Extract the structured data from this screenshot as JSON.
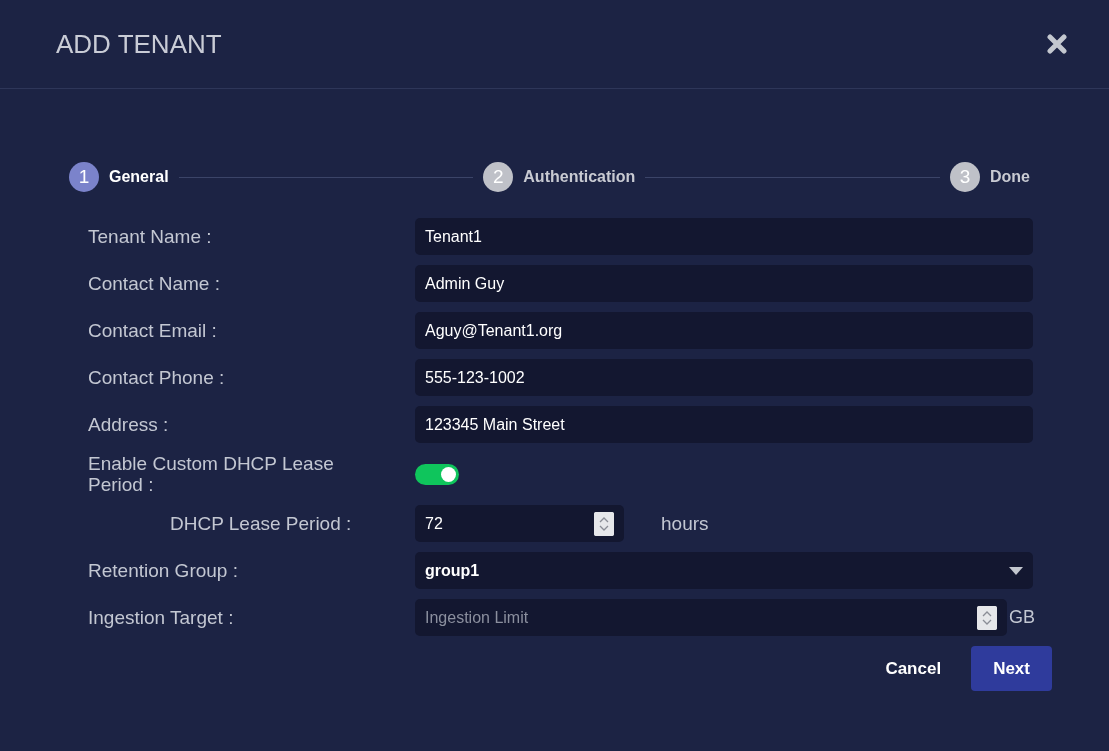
{
  "dialog": {
    "title": "ADD TENANT"
  },
  "steps": [
    {
      "number": "1",
      "label": "General",
      "selected": true
    },
    {
      "number": "2",
      "label": "Authentication",
      "selected": false
    },
    {
      "number": "3",
      "label": "Done",
      "selected": false
    }
  ],
  "rows": [
    {
      "kind": "text",
      "label": "Tenant Name :",
      "value": "Tenant1"
    },
    {
      "kind": "text",
      "label": "Contact Name :",
      "value": "Admin Guy"
    },
    {
      "kind": "text",
      "label": "Contact Email :",
      "value": "Aguy@Tenant1.org"
    },
    {
      "kind": "text",
      "label": "Contact Phone :",
      "value": "555-123-1002"
    },
    {
      "kind": "text",
      "label": "Address :",
      "value": "123345 Main Street"
    },
    {
      "kind": "toggle",
      "label": "Enable Custom DHCP Lease Period :",
      "on": true,
      "children": [
        {
          "kind": "number",
          "label": "DHCP Lease Period :",
          "value": "72",
          "unit": "hours"
        }
      ]
    },
    {
      "kind": "select",
      "label": "Retention Group :",
      "value": "group1"
    },
    {
      "kind": "number",
      "label": "Ingestion Target :",
      "placeholder": "Ingestion Limit",
      "unit": "GB"
    }
  ],
  "buttons": [
    {
      "label": "Cancel",
      "kind": "secondary"
    },
    {
      "label": "Next",
      "kind": "primary"
    }
  ]
}
